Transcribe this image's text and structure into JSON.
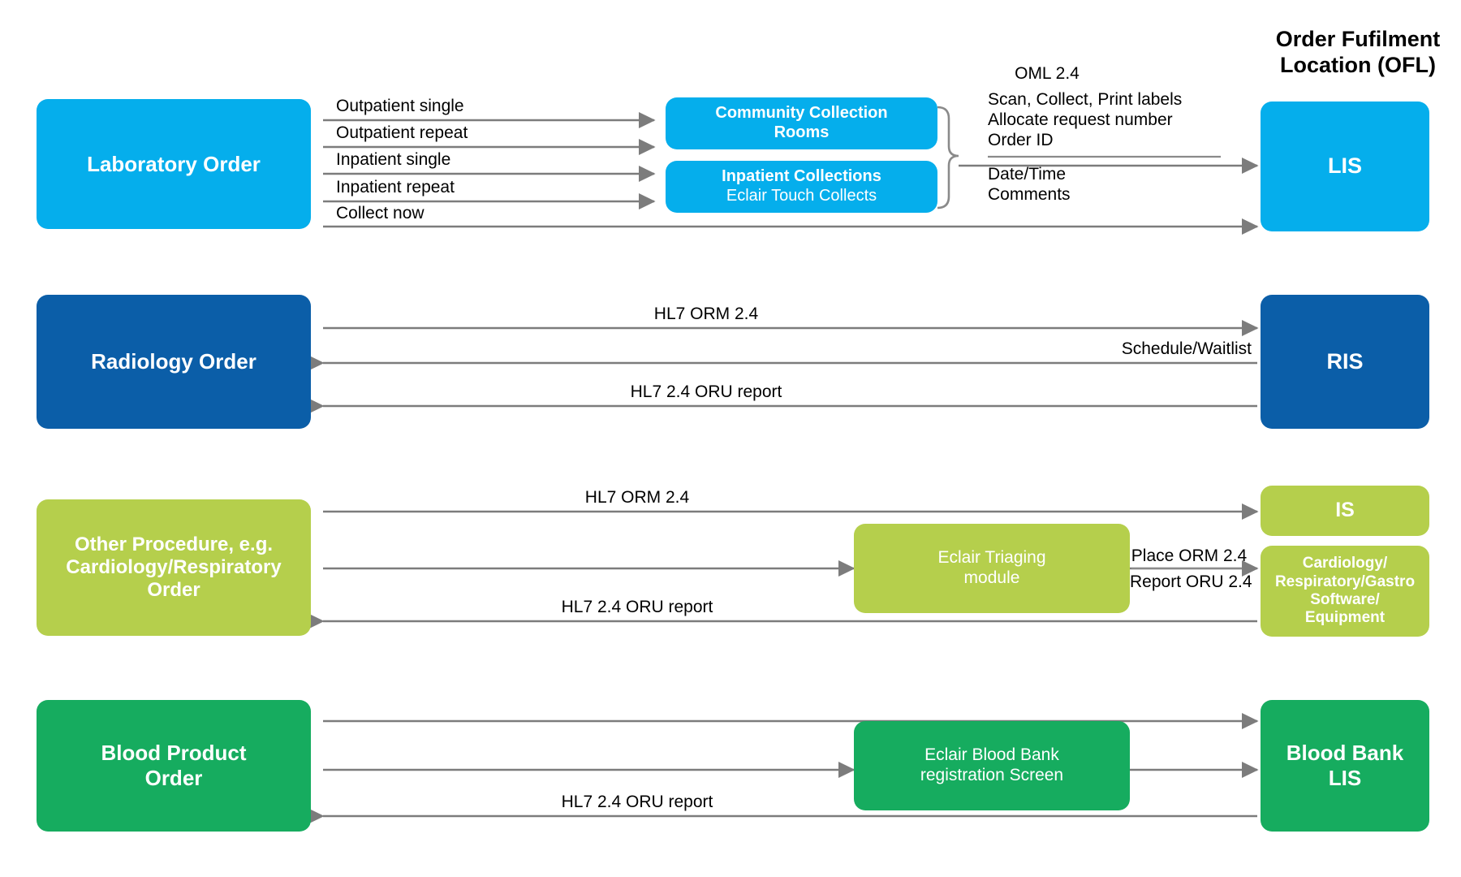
{
  "header": {
    "title_line1": "Order Fufilment",
    "title_line2": "Location (OFL)"
  },
  "rows": {
    "laboratory": {
      "source_label": "Laboratory Order",
      "flow_labels": [
        "Outpatient single",
        "Outpatient repeat",
        "Inpatient single",
        "Inpatient repeat",
        "Collect now"
      ],
      "mid_boxes": [
        {
          "line1": "Community Collection",
          "line2": "Rooms"
        },
        {
          "line1": "Inpatient Collections",
          "line2": "Eclair Touch Collects"
        }
      ],
      "detail": {
        "heading": "OML 2.4",
        "above": [
          "Scan, Collect, Print labels",
          "Allocate request number",
          "Order ID"
        ],
        "below": [
          "Date/Time",
          "Comments"
        ]
      },
      "target_label": "LIS"
    },
    "radiology": {
      "source_label": "Radiology Order",
      "flow_labels": [
        "HL7 ORM 2.4",
        "Schedule/Waitlist",
        "HL7 2.4 ORU report"
      ],
      "target_label": "RIS"
    },
    "other_procedure": {
      "source_line1": "Other Procedure, e.g.",
      "source_line2": "Cardiology/Respiratory",
      "source_line3": "Order",
      "flow_labels": [
        "HL7 ORM 2.4",
        "HL7 2.4 ORU report"
      ],
      "mid_box": {
        "line1": "Eclair Triaging",
        "line2": "module"
      },
      "link_labels": {
        "above": "Place ORM 2.4",
        "below": "Report ORU 2.4"
      },
      "target_top_label": "IS",
      "target_bottom": {
        "line1": "Cardiology/",
        "line2": "Respiratory/Gastro",
        "line3": "Software/ Equipment"
      }
    },
    "blood_product": {
      "source_line1": "Blood Product",
      "source_line2": "Order",
      "flow_labels": [
        "HL7 2.4 ORU report"
      ],
      "mid_box": {
        "line1": "Eclair Blood Bank",
        "line2": "registration Screen"
      },
      "target_line1": "Blood Bank",
      "target_line2": "LIS"
    }
  },
  "colors": {
    "light_blue": "#05AEEC",
    "dark_blue": "#0B5EA8",
    "lime_green": "#B5CF4C",
    "emerald_green": "#16AC5F",
    "arrow_gray": "#7C7C7C"
  }
}
